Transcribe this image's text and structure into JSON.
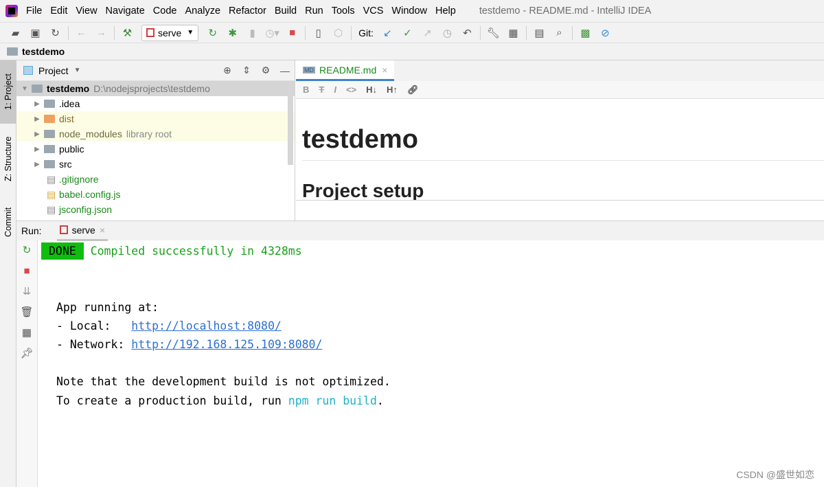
{
  "menubar": {
    "items": [
      "File",
      "Edit",
      "View",
      "Navigate",
      "Code",
      "Analyze",
      "Refactor",
      "Build",
      "Run",
      "Tools",
      "VCS",
      "Window",
      "Help"
    ],
    "window_title": "testdemo - README.md - IntelliJ IDEA"
  },
  "toolbar": {
    "run_config": "serve",
    "git_label": "Git:"
  },
  "navbar": {
    "project": "testdemo"
  },
  "stripe": {
    "project": "1: Project",
    "structure": "Z: Structure",
    "commit": "Commit"
  },
  "project": {
    "title": "Project",
    "root": {
      "name": "testdemo",
      "path": "D:\\nodejsprojects\\testdemo"
    },
    "items": [
      {
        "name": ".idea",
        "type": "folder"
      },
      {
        "name": "dist",
        "type": "folder"
      },
      {
        "name": "node_modules",
        "type": "folder",
        "note": "library root"
      },
      {
        "name": "public",
        "type": "folder"
      },
      {
        "name": "src",
        "type": "folder"
      },
      {
        "name": ".gitignore",
        "type": "file"
      },
      {
        "name": "babel.config.js",
        "type": "file"
      },
      {
        "name": "jsconfig.json",
        "type": "file"
      }
    ]
  },
  "editor": {
    "tab": "README.md",
    "md_toolbar": [
      "B",
      "S",
      "I",
      "<>",
      "H↓",
      "H↑",
      "link"
    ],
    "h1": "testdemo",
    "h2": "Project setup"
  },
  "run": {
    "label": "Run:",
    "tab": "serve"
  },
  "console": {
    "done_badge": "DONE",
    "compiled": "Compiled successfully in 4328ms",
    "app_running": "App running at:",
    "local_label": "- Local:   ",
    "local_url": "http://localhost:8080/",
    "network_label": "- Network: ",
    "network_url": "http://192.168.125.109:8080/",
    "note": "Note that the development build is not optimized.",
    "create_prefix": "To create a production build, run ",
    "create_cmd": "npm run build",
    "create_suffix": "."
  },
  "watermark": "CSDN @盛世如恋"
}
